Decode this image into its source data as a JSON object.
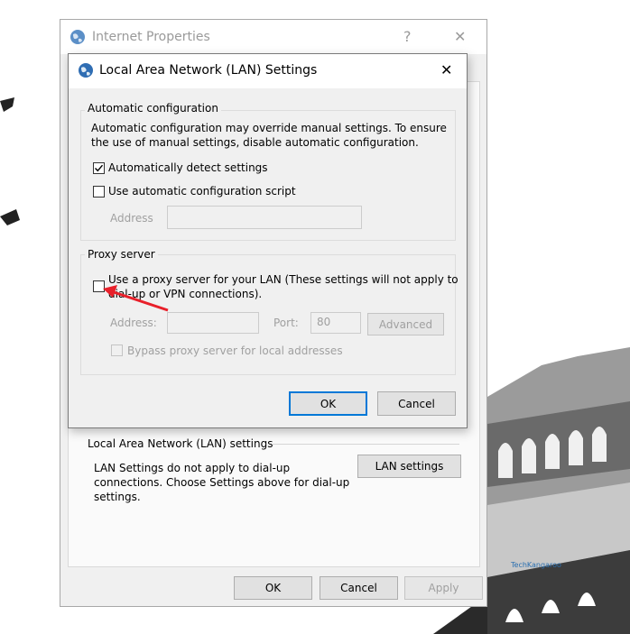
{
  "outer_dialog": {
    "title": "Internet Properties",
    "help_glyph": "?",
    "close_glyph": "✕",
    "lan_section_title": "Local Area Network (LAN) settings",
    "lan_note": [
      "LAN Settings do not apply to dial-up",
      "connections. Choose Settings above for dial-up",
      "settings."
    ],
    "lan_settings_button": "LAN settings",
    "ok_button": "OK",
    "cancel_button": "Cancel",
    "apply_button": "Apply"
  },
  "lan_dialog": {
    "title": "Local Area Network (LAN) Settings",
    "close_glyph": "✕",
    "auto_config": {
      "group_label": "Automatic configuration",
      "description": [
        "Automatic configuration may override manual settings.  To ensure",
        "the use of manual settings, disable automatic configuration."
      ],
      "auto_detect_label": "Automatically detect settings",
      "auto_detect_checked": true,
      "script_label": "Use automatic configuration script",
      "script_checked": false,
      "address_label": "Address",
      "address_value": ""
    },
    "proxy": {
      "group_label": "Proxy server",
      "use_proxy_label": [
        "Use a proxy server for your LAN (These settings will not apply to",
        "dial-up or VPN connections)."
      ],
      "use_proxy_checked": false,
      "address_label": "Address:",
      "address_value": "",
      "port_label": "Port:",
      "port_value": "80",
      "advanced_button": "Advanced",
      "bypass_label": "Bypass proxy server for local addresses",
      "bypass_checked": false
    },
    "ok_button": "OK",
    "cancel_button": "Cancel"
  },
  "watermark": "TechKangaroo",
  "colors": {
    "dialog_bg": "#f0f0f0",
    "accent": "#0078d7",
    "arrow": "#e8202a",
    "disabled_text": "#a0a0a0"
  }
}
